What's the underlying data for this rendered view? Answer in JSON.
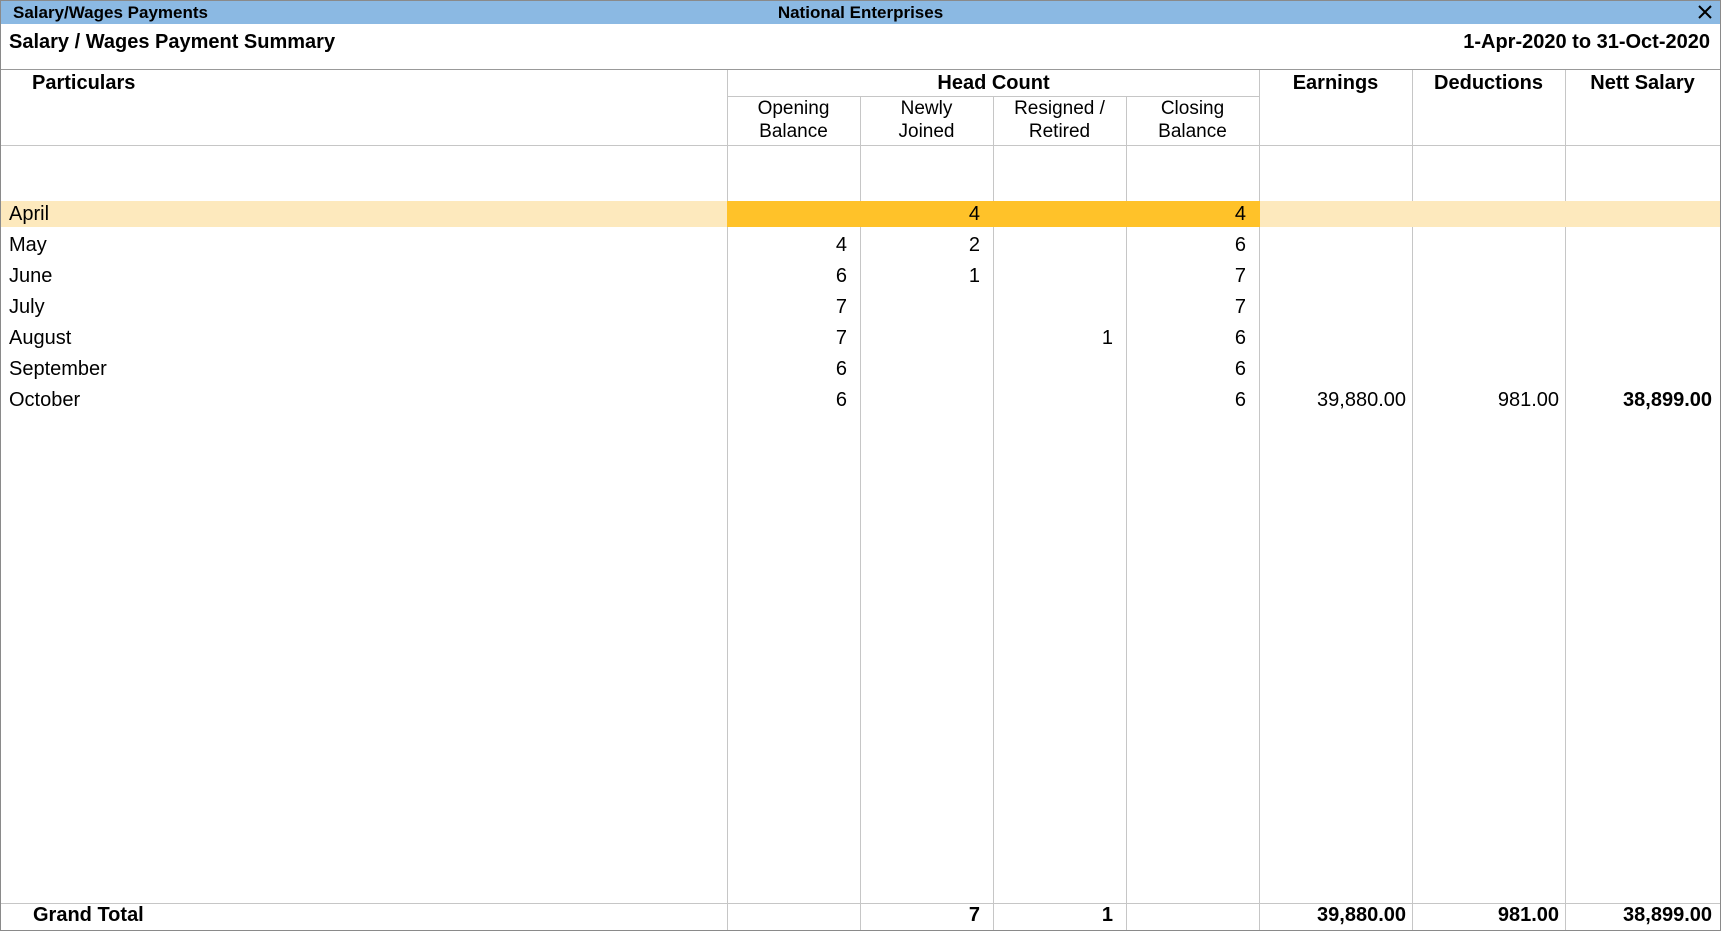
{
  "window": {
    "title": "Salary/Wages Payments",
    "company": "National Enterprises",
    "close_icon": "close-icon"
  },
  "report": {
    "title": "Salary / Wages Payment Summary",
    "period": "1-Apr-2020 to 31-Oct-2020"
  },
  "columns": {
    "particulars": "Particulars",
    "head_count": "Head Count",
    "opening_1": "Opening",
    "opening_2": "Balance",
    "newly_1": "Newly",
    "newly_2": "Joined",
    "resigned_1": "Resigned /",
    "resigned_2": "Retired",
    "closing_1": "Closing",
    "closing_2": "Balance",
    "earnings": "Earnings",
    "deductions": "Deductions",
    "nett_salary": "Nett Salary"
  },
  "rows": [
    {
      "month": "April",
      "opening": "",
      "joined": "4",
      "resigned": "",
      "closing": "4",
      "earnings": "",
      "deductions": "",
      "nett": ""
    },
    {
      "month": "May",
      "opening": "4",
      "joined": "2",
      "resigned": "",
      "closing": "6",
      "earnings": "",
      "deductions": "",
      "nett": ""
    },
    {
      "month": "June",
      "opening": "6",
      "joined": "1",
      "resigned": "",
      "closing": "7",
      "earnings": "",
      "deductions": "",
      "nett": ""
    },
    {
      "month": "July",
      "opening": "7",
      "joined": "",
      "resigned": "",
      "closing": "7",
      "earnings": "",
      "deductions": "",
      "nett": ""
    },
    {
      "month": "August",
      "opening": "7",
      "joined": "",
      "resigned": "1",
      "closing": "6",
      "earnings": "",
      "deductions": "",
      "nett": ""
    },
    {
      "month": "September",
      "opening": "6",
      "joined": "",
      "resigned": "",
      "closing": "6",
      "earnings": "",
      "deductions": "",
      "nett": ""
    },
    {
      "month": "October",
      "opening": "6",
      "joined": "",
      "resigned": "",
      "closing": "6",
      "earnings": "39,880.00",
      "deductions": "981.00",
      "nett": "38,899.00"
    }
  ],
  "grand_total": {
    "label": "Grand Total",
    "opening": "",
    "joined": "7",
    "resigned": "1",
    "closing": "",
    "earnings": "39,880.00",
    "deductions": "981.00",
    "nett": "38,899.00"
  },
  "colors": {
    "title_bar": "#8bb9e3",
    "selected_row": "#fde9bd",
    "selected_headcount": "#ffc229"
  }
}
